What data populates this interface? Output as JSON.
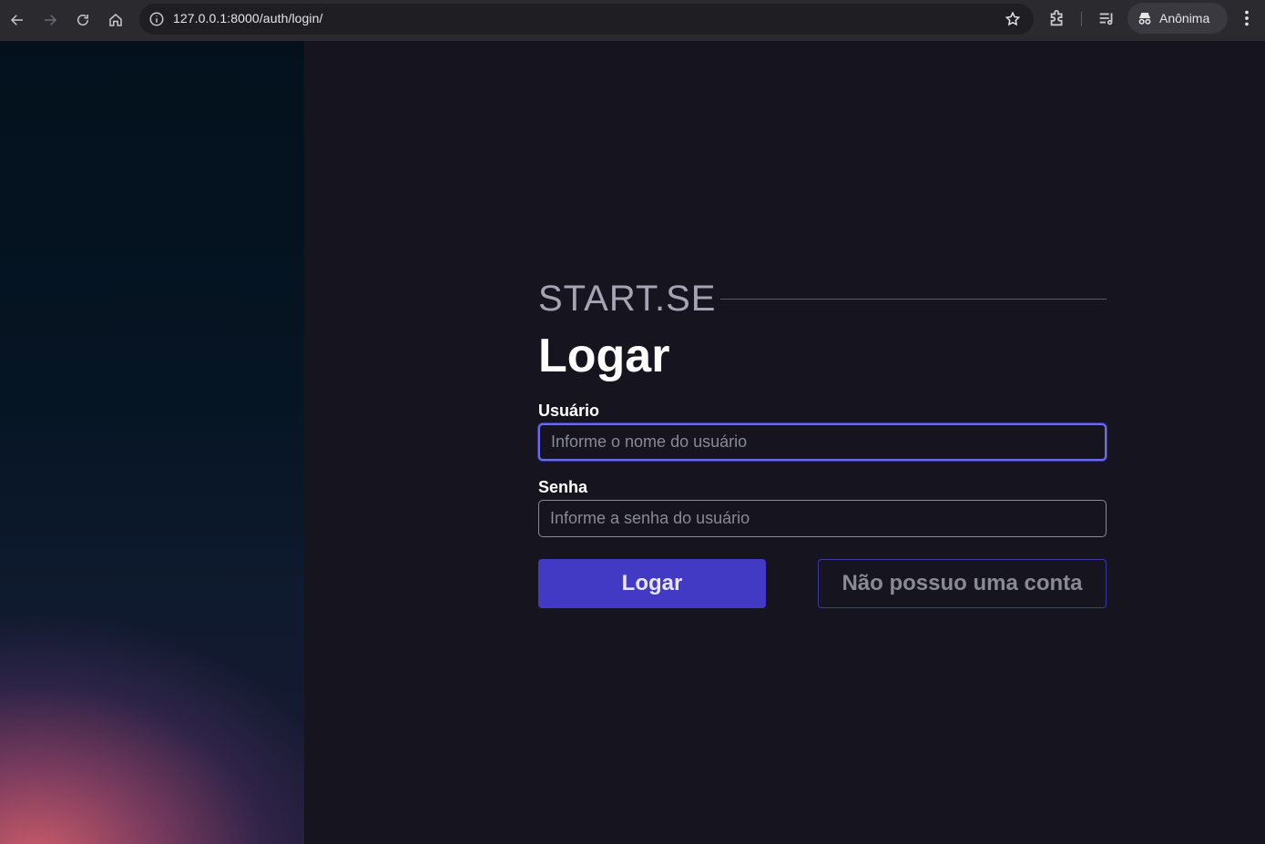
{
  "browser": {
    "url": "127.0.0.1:8000/auth/login/",
    "profile_label": "Anônima",
    "icons": {
      "back": "back-arrow-icon",
      "forward": "forward-arrow-icon",
      "reload": "reload-icon",
      "home": "home-icon",
      "site_info": "info-icon",
      "bookmark": "star-icon",
      "extensions": "puzzle-icon",
      "media": "media-queue-icon",
      "incognito": "incognito-icon",
      "menu": "kebab-menu-icon"
    }
  },
  "page": {
    "brand": "START.SE",
    "title": "Logar",
    "username": {
      "label": "Usuário",
      "placeholder": "Informe o nome do usuário",
      "value": ""
    },
    "password": {
      "label": "Senha",
      "placeholder": "Informe a senha do usuário",
      "value": ""
    },
    "login_button": "Logar",
    "signup_button": "Não possuo uma conta"
  },
  "colors": {
    "background": "#16151f",
    "primary": "#4239c4",
    "focus_border": "#6e6de0"
  }
}
